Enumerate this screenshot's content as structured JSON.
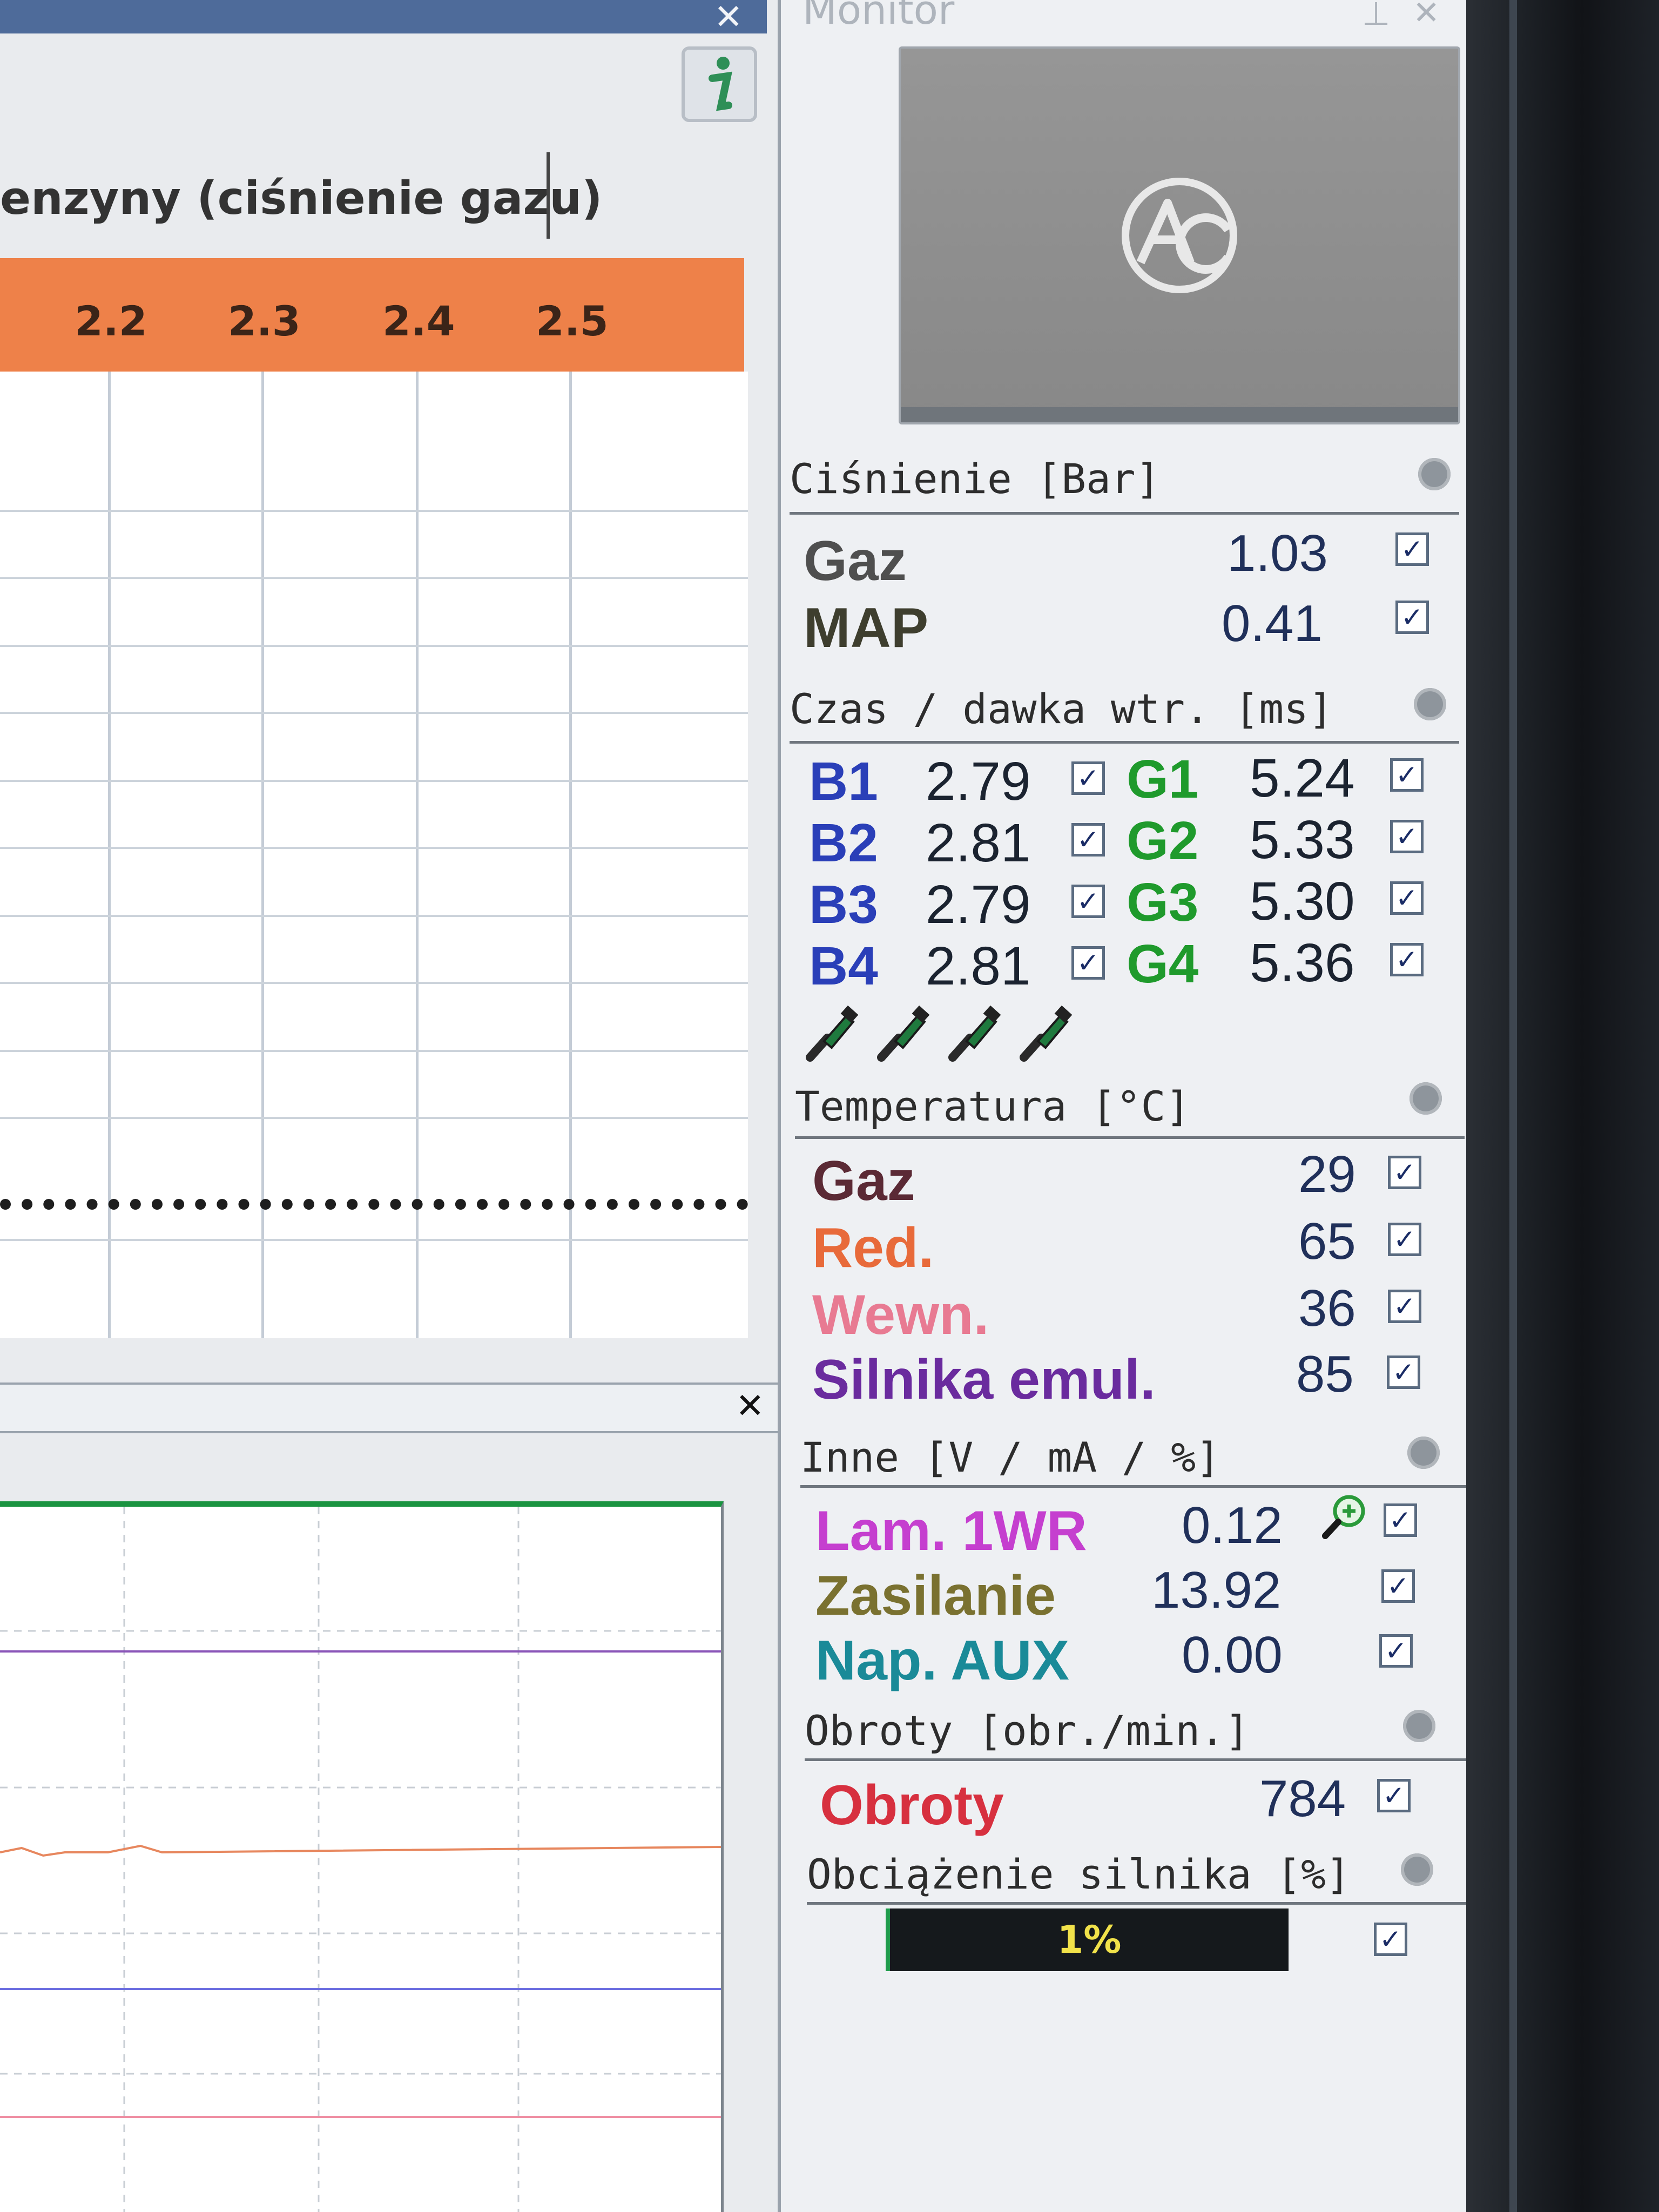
{
  "left_window": {
    "map_title": "enzyny (ciśnienie gazu)",
    "axis_ticks": [
      "2.2",
      "2.3",
      "2.4",
      "2.5"
    ],
    "close_symbol": "✕",
    "info_icon": "info-icon",
    "chart_close_symbol": "✕"
  },
  "monitor": {
    "title": "Monitor",
    "pin_symbol": "⊥",
    "close_symbol": "✕",
    "pressure": {
      "title": "Ciśnienie [Bar]",
      "rows": [
        {
          "label": "Gaz",
          "value": "1.03",
          "color": "#4f4f4f"
        },
        {
          "label": "MAP",
          "value": "0.41",
          "color": "#3e3e2e"
        }
      ]
    },
    "injection": {
      "title": "Czas / dawka wtr. [ms]",
      "petrol": [
        {
          "label": "B1",
          "value": "2.79"
        },
        {
          "label": "B2",
          "value": "2.81"
        },
        {
          "label": "B3",
          "value": "2.79"
        },
        {
          "label": "B4",
          "value": "2.81"
        }
      ],
      "gas": [
        {
          "label": "G1",
          "value": "5.24"
        },
        {
          "label": "G2",
          "value": "5.33"
        },
        {
          "label": "G3",
          "value": "5.30"
        },
        {
          "label": "G4",
          "value": "5.36"
        }
      ],
      "petrol_color": "#2a3fb8",
      "gas_color": "#1f9a2c",
      "injector_icons": [
        "injector-icon",
        "injector-icon",
        "injector-icon",
        "injector-icon"
      ]
    },
    "temperature": {
      "title": "Temperatura [°C]",
      "rows": [
        {
          "label": "Gaz",
          "value": "29",
          "color": "#5b2a35"
        },
        {
          "label": "Red.",
          "value": "65",
          "color": "#e86a3a"
        },
        {
          "label": "Wewn.",
          "value": "36",
          "color": "#e87a92"
        },
        {
          "label": "Silnika emul.",
          "value": "85",
          "color": "#6a2b9e"
        }
      ]
    },
    "other": {
      "title": "Inne [V / mA / %]",
      "rows": [
        {
          "label": "Lam. 1WR",
          "value": "0.12",
          "color": "#c53fcf"
        },
        {
          "label": "Zasilanie",
          "value": "13.92",
          "color": "#7a7130"
        },
        {
          "label": "Nap. AUX",
          "value": "0.00",
          "color": "#1a8a98"
        }
      ],
      "zoom_icon": "zoom-in-icon"
    },
    "rpm": {
      "title": "Obroty [obr./min.]",
      "label": "Obroty",
      "value": "784",
      "color": "#d7303f"
    },
    "load": {
      "title": "Obciążenie silnika [%]",
      "value_text": "1%",
      "percent": 1
    },
    "check_symbol": "✓"
  }
}
